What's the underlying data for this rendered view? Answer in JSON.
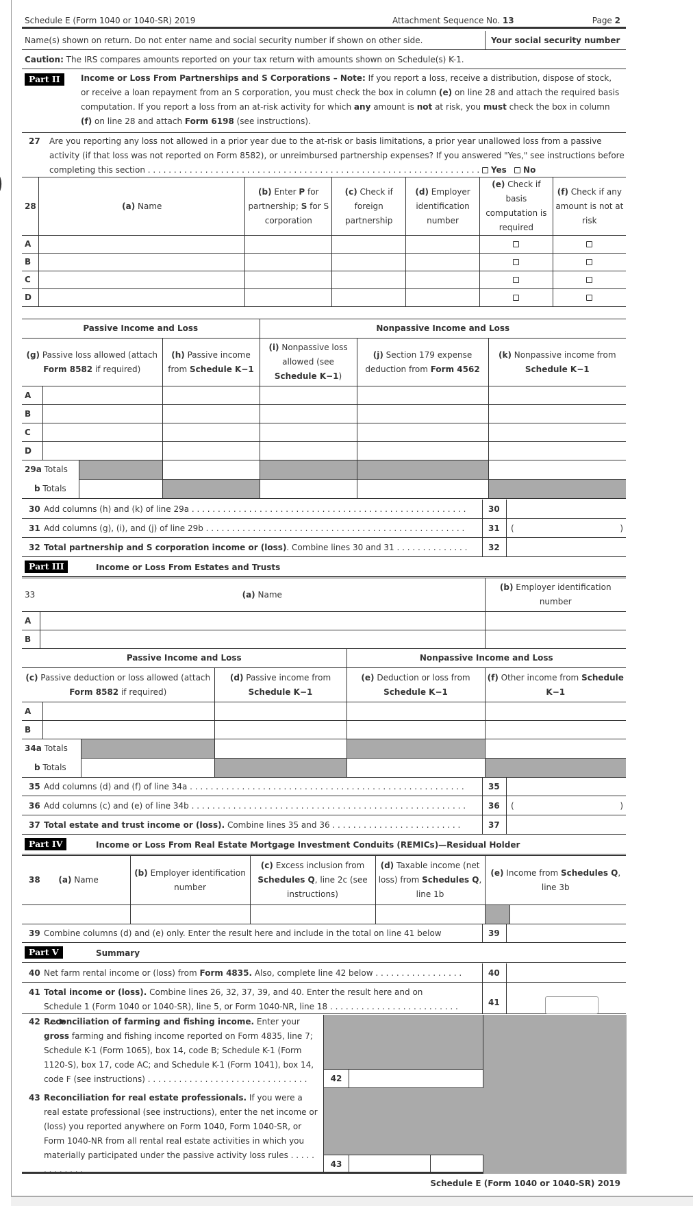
{
  "header": {
    "form_title": "Schedule E (Form 1040 or 1040-SR) 2019",
    "attachment_prefix": "Attachment Sequence No. ",
    "attachment_no": "13",
    "page_prefix": "Page ",
    "page_no": "2"
  },
  "names_row": {
    "label": "Name(s) shown on return. Do not enter name and social security number if shown on other side.",
    "ssn_label": "Your social security number"
  },
  "caution": {
    "label": "Caution:",
    "text": " The IRS compares amounts reported on your tax return with amounts shown on Schedule(s) K-1."
  },
  "part2": {
    "tag": "Part II",
    "title": "Income or Loss From Partnerships and S Corporations – ",
    "note_label": "Note:",
    "text1": " If you report a loss, receive a distribution, dispose of stock, or receive a loan repayment from an S corporation, you must check the box in column ",
    "col_e": "(e)",
    "text2": " on line 28 and attach the required basis computation. If you report a loss from an at-risk activity for which ",
    "any": "any",
    "text3": " amount is ",
    "not": "not",
    "text4": " at risk, you ",
    "must": "must",
    "text5": " check the box in column ",
    "col_f": "(f)",
    "text6": " on line 28 and attach ",
    "form6198": "Form 6198",
    "text7": " (see instructions).",
    "line27": {
      "num": "27",
      "text": "Are you reporting any loss not allowed in a prior year due to the at-risk or basis limitations, a prior year unallowed loss from a passive activity (if that loss was not reported on Form 8582), or unreimbursed partnership expenses? If you answered \"Yes,\" see instructions before completing this section . . . . . . . . . . . . . . . . . . . . . . . . . . . . . . . . . . . . . . . . . . . . . . . . . . . . . . . . . . . . . . . .",
      "yes": "Yes",
      "no": "No"
    },
    "line28": {
      "num": "28",
      "col_a": "(a)",
      "col_a_text": " Name",
      "col_b": "(b)",
      "col_b_text1": " Enter ",
      "col_b_p": "P",
      "col_b_text2": " for partnership; ",
      "col_b_s": "S",
      "col_b_text3": " for S corporation",
      "col_c": "(c)",
      "col_c_text": " Check if foreign partnership",
      "col_d": "(d)",
      "col_d_text": " Employer identification number",
      "col_e": "(e)",
      "col_e_text": " Check if basis computation is required",
      "col_f": "(f)",
      "col_f_text": " Check if any amount is not at risk",
      "rows": [
        "A",
        "B",
        "C",
        "D"
      ]
    },
    "passive_header": "Passive Income and Loss",
    "nonpassive_header": "Nonpassive Income and Loss",
    "col_g": "(g)",
    "col_g_text1": " Passive loss allowed (attach ",
    "col_g_bold": "Form 8582",
    "col_g_text2": " if required)",
    "col_h": "(h)",
    "col_h_text1": " Passive income from ",
    "col_h_bold": "Schedule K−1",
    "col_i": "(i)",
    "col_i_text1": " Nonpassive loss allowed (see ",
    "col_i_bold": "Schedule K−1",
    "col_i_text2": ")",
    "col_j": "(j)",
    "col_j_text1": " Section 179 expense deduction from ",
    "col_j_bold": "Form 4562",
    "col_k": "(k)",
    "col_k_text1": " Nonpassive income from ",
    "col_k_bold": "Schedule K−1",
    "rows2": [
      "A",
      "B",
      "C",
      "D"
    ],
    "l29a_num": "29a",
    "l29a_label": " Totals",
    "l29b_num": "b",
    "l29b_label": " Totals",
    "l30": {
      "num": "30",
      "text": "Add columns (h) and (k) of line 29a . . . . . . . . . . . . . . . . . . . . . . . . . . . . . . . . . . . . . . . . . . . . . . . . . . . . .",
      "box": "30"
    },
    "l31": {
      "num": "31",
      "text": "Add columns (g), (i), and (j) of line 29b . . . . . . . . . . . . . . . . . . . . . . . . . . . . . . . . . . . . . . . . . . . . . . . . . .",
      "box": "31",
      "paren_l": "(",
      "paren_r": ")"
    },
    "l32": {
      "num": "32",
      "bold": "Total partnership and S corporation income or (loss)",
      "text": ". Combine lines 30 and 31 . . . . . . . . . . . . . .",
      "box": "32"
    }
  },
  "part3": {
    "tag": "Part III",
    "title": "Income or Loss From Estates and Trusts",
    "l33_num": "33",
    "col_a": "(a)",
    "col_a_text": " Name",
    "col_b": "(b)",
    "col_b_text": " Employer identification number",
    "rows": [
      "A",
      "B"
    ],
    "passive_header": "Passive Income and Loss",
    "nonpassive_header": "Nonpassive Income and Loss",
    "col_c": "(c)",
    "col_c_text1": " Passive deduction or loss allowed (attach ",
    "col_c_bold": "Form 8582",
    "col_c_text2": " if required)",
    "col_d": "(d)",
    "col_d_text1": " Passive income from ",
    "col_d_bold": "Schedule K−1",
    "col_e": "(e)",
    "col_e_text1": " Deduction or loss from ",
    "col_e_bold": "Schedule K−1",
    "col_f": "(f)",
    "col_f_text1": " Other income from ",
    "col_f_bold": "Schedule K−1",
    "rows2": [
      "A",
      "B"
    ],
    "l34a_num": "34a",
    "l34a_label": " Totals",
    "l34b_num": "b",
    "l34b_label": " Totals",
    "l35": {
      "num": "35",
      "text": "Add columns (d) and (f) of line 34a . . . . . . . . . . . . . . . . . . . . . . . . . . . . . . . . . . . . . . . . . . . . . . . . . . . . .",
      "box": "35"
    },
    "l36": {
      "num": "36",
      "text": "Add columns (c) and (e) of line 34b . . . . . . . . . . . . . . . . . . . . . . . . . . . . . . . . . . . . . . . . . . . . . . . . . . . . .",
      "box": "36",
      "paren_l": "(",
      "paren_r": ")"
    },
    "l37": {
      "num": "37",
      "bold": "Total estate and trust income or (loss).",
      "text": " Combine lines 35 and 36 . . . . . . . . . . . . . . . . . . . . . . . . .",
      "box": "37"
    }
  },
  "part4": {
    "tag": "Part IV",
    "title": "Income or Loss From Real Estate Mortgage Investment Conduits (REMICs)—Residual Holder",
    "l38_num": "38",
    "col_a": "(a)",
    "col_a_text": " Name",
    "col_b": "(b)",
    "col_b_text": " Employer identification number",
    "col_c": "(c)",
    "col_c_text1": " Excess inclusion from ",
    "col_c_bold": "Schedules Q",
    "col_c_text2": ", line 2c (see instructions)",
    "col_d": "(d)",
    "col_d_text1": " Taxable income (net loss) from ",
    "col_d_bold": "Schedules Q",
    "col_d_text2": ", line 1b",
    "col_e": "(e)",
    "col_e_text1": " Income from ",
    "col_e_bold": "Schedules Q",
    "col_e_text2": ", line 3b",
    "l39": {
      "num": "39",
      "text": "Combine columns (d) and (e) only. Enter the result here and include in the total on line 41 below",
      "box": "39"
    }
  },
  "part5": {
    "tag": "Part V",
    "title": "Summary",
    "l40": {
      "num": "40",
      "text1": "Net farm rental income or (loss) from ",
      "bold": "Form 4835.",
      "text2": " Also, complete line 42 below . . . . . . . . . . . . . . . . .",
      "box": "40"
    },
    "l41": {
      "num": "41",
      "bold": "Total income or (loss).",
      "text": " Combine lines 26, 32, 37, 39, and 40. Enter the result here and on Schedule 1 (Form 1040 or 1040-SR), line 5, or Form 1040-NR, line 18 . . . . . . . . . . . . . . . . . . . . . . . . . . . . ▶",
      "box": "41",
      "input_value": ""
    },
    "l42": {
      "num": "42",
      "bold": "Reconciliation of farming and fishing income.",
      "text1": " Enter your ",
      "gross": "gross",
      "text2": " farming and fishing income reported on Form 4835, line 7; Schedule K-1 (Form 1065), box 14, code B; Schedule K-1 (Form 1120-S), box 17, code AC; and Schedule K-1 (Form 1041), box 14, code F (see instructions) . . . . . . . . . . . . . . . . . . . . . . . . . . . . . . .",
      "box": "42"
    },
    "l43": {
      "num": "43",
      "bold": "Reconciliation for real estate professionals.",
      "text": " If you were a real estate professional (see instructions), enter the net income or (loss) you reported anywhere on Form 1040, Form 1040-SR, or Form 1040-NR from all rental real estate activities in which you materially participated under the passive activity loss rules . . . . . . . . . . . . .",
      "box": "43"
    }
  },
  "footer": "Schedule E (Form 1040 or 1040-SR) 2019"
}
